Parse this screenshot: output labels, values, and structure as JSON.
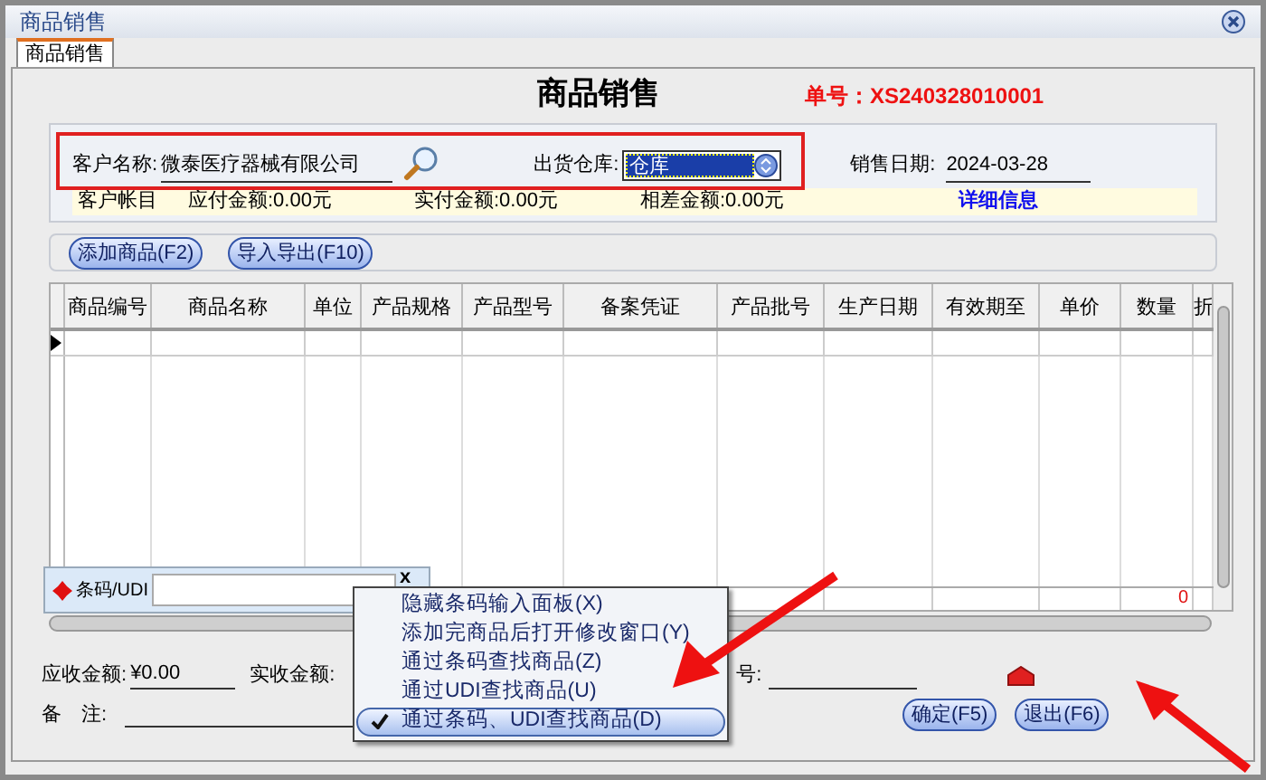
{
  "window": {
    "title": "商品销售"
  },
  "tabs": [
    {
      "label": "商品销售",
      "selected": true
    }
  ],
  "heading": "商品销售",
  "order_number": "单号：XS240328010001",
  "form": {
    "customer_label": "客户名称:",
    "customer_value": "微泰医疗器械有限公司",
    "warehouse_label": "出货仓库:",
    "warehouse_value": "仓库",
    "date_label": "销售日期:",
    "date_value": "2024-03-28"
  },
  "ledger": {
    "label": "客户帐目",
    "payable": "应付金额:0.00元",
    "paid": "实付金额:0.00元",
    "difference": "相差金额:0.00元",
    "link": "详细信息"
  },
  "toolbar": [
    "添加商品(F2)",
    "导入导出(F10)"
  ],
  "table": {
    "columns": [
      "商品编号",
      "商品名称",
      "单位",
      "产品规格",
      "产品型号",
      "备案凭证",
      "产品批号",
      "生产日期",
      "有效期至",
      "单价",
      "数量",
      "折"
    ],
    "total_quantity": "0"
  },
  "barcode_panel": {
    "label": "条码/UDI",
    "close": "x"
  },
  "context_menu": [
    {
      "label": "隐藏条码输入面板(X)",
      "checked": false,
      "selected": false
    },
    {
      "label": "添加完商品后打开修改窗口(Y)",
      "checked": false,
      "selected": false
    },
    {
      "label": "通过条码查找商品(Z)",
      "checked": false,
      "selected": false
    },
    {
      "label": "通过UDI查找商品(U)",
      "checked": false,
      "selected": false
    },
    {
      "label": "通过条码、UDI查找商品(D)",
      "checked": true,
      "selected": true
    }
  ],
  "bottom": {
    "receivable_label": "应收金额:",
    "receivable_value": "¥0.00",
    "received_label": "实收金额:",
    "number_label": "号:",
    "remarks_label": "备　注:"
  },
  "buttons": [
    "确定(F5)",
    "退出(F6)"
  ]
}
